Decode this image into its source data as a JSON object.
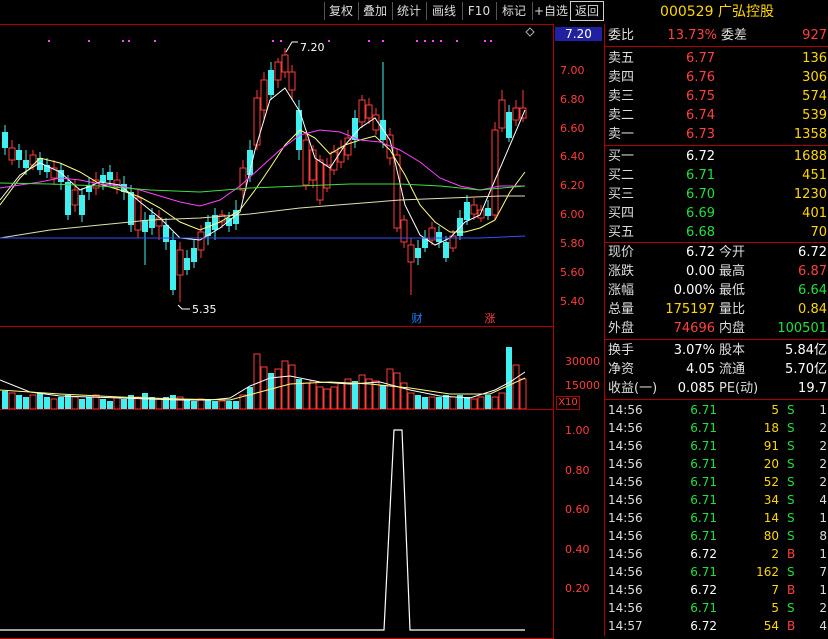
{
  "toolbar": {
    "buttons": [
      "复权",
      "叠加",
      "统计",
      "画线",
      "F10",
      "标记",
      "+自选",
      "返回"
    ]
  },
  "ticker": {
    "code": "000529",
    "name": "广弘控股"
  },
  "main_chart": {
    "current_price_label": "7.20",
    "y_ticks": [
      "7.00",
      "6.80",
      "6.60",
      "6.40",
      "6.20",
      "6.00",
      "5.80",
      "5.60",
      "5.40"
    ],
    "high_annotation": "7.20",
    "low_annotation": "5.35",
    "badges": [
      {
        "text": "财",
        "color": "#2080ff"
      },
      {
        "text": "涨",
        "color": "#ff4040"
      }
    ]
  },
  "volume_chart": {
    "y_ticks": [
      "30000",
      "15000"
    ],
    "multiplier_label": "X10"
  },
  "indicator_chart": {
    "y_ticks": [
      "1.00",
      "0.80",
      "0.60",
      "0.40",
      "0.20"
    ]
  },
  "order_book": {
    "ratio": {
      "label": "委比",
      "value": "13.73%",
      "diff_label": "委差",
      "diff_value": "927"
    },
    "asks": [
      {
        "label": "卖五",
        "price": "6.77",
        "volume": "136"
      },
      {
        "label": "卖四",
        "price": "6.76",
        "volume": "306"
      },
      {
        "label": "卖三",
        "price": "6.75",
        "volume": "574"
      },
      {
        "label": "卖二",
        "price": "6.74",
        "volume": "539"
      },
      {
        "label": "卖一",
        "price": "6.73",
        "volume": "1358"
      }
    ],
    "bids": [
      {
        "label": "买一",
        "price": "6.72",
        "volume": "1688",
        "color": "#ffffff"
      },
      {
        "label": "买二",
        "price": "6.71",
        "volume": "451",
        "color": "#20e040"
      },
      {
        "label": "买三",
        "price": "6.70",
        "volume": "1230",
        "color": "#20e040"
      },
      {
        "label": "买四",
        "price": "6.69",
        "volume": "401",
        "color": "#20e040"
      },
      {
        "label": "买五",
        "price": "6.68",
        "volume": "70",
        "color": "#20e040"
      }
    ]
  },
  "quote": {
    "rows": [
      {
        "l1": "现价",
        "v1": "6.72",
        "c1": "#ffffff",
        "l2": "今开",
        "v2": "6.72",
        "c2": "#ffffff"
      },
      {
        "l1": "涨跌",
        "v1": "0.00",
        "c1": "#ffffff",
        "l2": "最高",
        "v2": "6.87",
        "c2": "#ff4040"
      },
      {
        "l1": "涨幅",
        "v1": "0.00%",
        "c1": "#ffffff",
        "l2": "最低",
        "v2": "6.64",
        "c2": "#20e040"
      },
      {
        "l1": "总量",
        "v1": "175197",
        "c1": "#ffd700",
        "l2": "量比",
        "v2": "0.84",
        "c2": "#ffd700"
      },
      {
        "l1": "外盘",
        "v1": "74696",
        "c1": "#ff4040",
        "l2": "内盘",
        "v2": "100501",
        "c2": "#20e040"
      }
    ]
  },
  "fundamentals": {
    "rows": [
      {
        "l1": "换手",
        "v1": "3.07%",
        "l2": "股本",
        "v2": "5.84亿"
      },
      {
        "l1": "净资",
        "v1": "4.05",
        "l2": "流通",
        "v2": "5.70亿"
      },
      {
        "l1": "收益(一)",
        "v1": "0.085",
        "l2": "PE(动)",
        "v2": "19.7"
      }
    ]
  },
  "ticks": [
    {
      "time": "14:56",
      "price": "6.71",
      "vol": "5",
      "side": "S",
      "n": "1"
    },
    {
      "time": "14:56",
      "price": "6.71",
      "vol": "18",
      "side": "S",
      "n": "2"
    },
    {
      "time": "14:56",
      "price": "6.71",
      "vol": "91",
      "side": "S",
      "n": "2"
    },
    {
      "time": "14:56",
      "price": "6.71",
      "vol": "20",
      "side": "S",
      "n": "2"
    },
    {
      "time": "14:56",
      "price": "6.71",
      "vol": "52",
      "side": "S",
      "n": "2"
    },
    {
      "time": "14:56",
      "price": "6.71",
      "vol": "34",
      "side": "S",
      "n": "4"
    },
    {
      "time": "14:56",
      "price": "6.71",
      "vol": "14",
      "side": "S",
      "n": "1"
    },
    {
      "time": "14:56",
      "price": "6.71",
      "vol": "80",
      "side": "S",
      "n": "8"
    },
    {
      "time": "14:56",
      "price": "6.72",
      "vol": "2",
      "side": "B",
      "n": "1"
    },
    {
      "time": "14:56",
      "price": "6.71",
      "vol": "162",
      "side": "S",
      "n": "7"
    },
    {
      "time": "14:56",
      "price": "6.72",
      "vol": "7",
      "side": "B",
      "n": "1"
    },
    {
      "time": "14:56",
      "price": "6.71",
      "vol": "5",
      "side": "S",
      "n": "2"
    },
    {
      "time": "14:57",
      "price": "6.72",
      "vol": "54",
      "side": "B",
      "n": "4"
    }
  ]
}
